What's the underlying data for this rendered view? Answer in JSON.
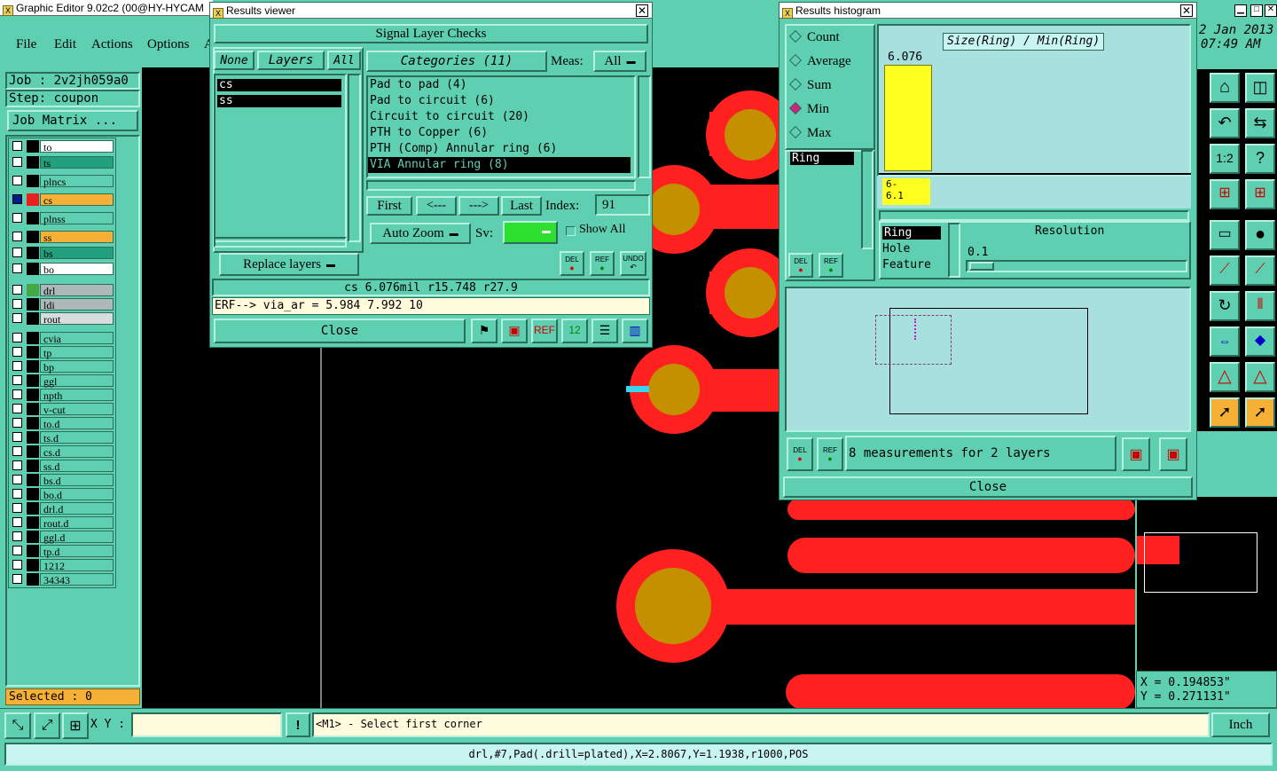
{
  "app": {
    "title": "Graphic Editor 9.02c2 (00@HY-HYCAM",
    "menu": [
      "File",
      "Edit",
      "Actions",
      "Options",
      "A"
    ],
    "job_label": "Job : 2v2jh059a0",
    "step_label": "Step: coupon",
    "job_matrix_label": "Job Matrix ...",
    "selected_label": "Selected : 0",
    "date": "2 Jan 2013",
    "time": "07:49 AM",
    "coord_x": "X = 0.194853\"",
    "coord_y": "Y = 0.271131\"",
    "xy_label": "X Y :",
    "xy_value": "",
    "prompt": "<M1> - Select first corner",
    "units": "Inch",
    "status_bar": "drl,#7,Pad(.drill=plated),X=2.8067,Y=1.1938,r1000,POS"
  },
  "layers": [
    {
      "name": "to",
      "color": "#ffffff",
      "swatch": "#000000"
    },
    {
      "name": "ts",
      "color": "#22a07e",
      "swatch": "#000000"
    },
    {
      "name": "plncs",
      "color": "#5fcfb1",
      "swatch": "#000000"
    },
    {
      "name": "cs",
      "color": "#f5b035",
      "swatch": "#e8201e",
      "active": true
    },
    {
      "name": "plnss",
      "color": "#5fcfb1",
      "swatch": "#000000"
    },
    {
      "name": "ss",
      "color": "#f5b035",
      "swatch": "#000000"
    },
    {
      "name": "bs",
      "color": "#22a07e",
      "swatch": "#000000"
    },
    {
      "name": "bo",
      "color": "#ffffff",
      "swatch": "#000000"
    },
    {
      "name": "drl",
      "color": "#aeb8b8",
      "swatch": "#44a844"
    },
    {
      "name": "ldi",
      "color": "#aeb8b8",
      "swatch": "#000000"
    },
    {
      "name": "rout",
      "color": "#d8dcdc",
      "swatch": "#000000"
    },
    {
      "name": "cvia",
      "color": "#5fcfb1",
      "swatch": "#000000"
    },
    {
      "name": "tp",
      "color": "#5fcfb1",
      "swatch": "#000000"
    },
    {
      "name": "bp",
      "color": "#5fcfb1",
      "swatch": "#000000"
    },
    {
      "name": "ggl",
      "color": "#5fcfb1",
      "swatch": "#000000"
    },
    {
      "name": "npth",
      "color": "#5fcfb1",
      "swatch": "#000000"
    },
    {
      "name": "v-cut",
      "color": "#5fcfb1",
      "swatch": "#000000"
    },
    {
      "name": "to.d",
      "color": "#5fcfb1",
      "swatch": "#000000"
    },
    {
      "name": "ts.d",
      "color": "#5fcfb1",
      "swatch": "#000000"
    },
    {
      "name": "cs.d",
      "color": "#5fcfb1",
      "swatch": "#000000"
    },
    {
      "name": "ss.d",
      "color": "#5fcfb1",
      "swatch": "#000000"
    },
    {
      "name": "bs.d",
      "color": "#5fcfb1",
      "swatch": "#000000"
    },
    {
      "name": "bo.d",
      "color": "#5fcfb1",
      "swatch": "#000000"
    },
    {
      "name": "drl.d",
      "color": "#5fcfb1",
      "swatch": "#000000"
    },
    {
      "name": "rout.d",
      "color": "#5fcfb1",
      "swatch": "#000000"
    },
    {
      "name": "ggl.d",
      "color": "#5fcfb1",
      "swatch": "#000000"
    },
    {
      "name": "tp.d",
      "color": "#5fcfb1",
      "swatch": "#000000"
    },
    {
      "name": "1212",
      "color": "#5fcfb1",
      "swatch": "#000000"
    },
    {
      "name": "34343",
      "color": "#5fcfb1",
      "swatch": "#000000"
    }
  ],
  "results_viewer": {
    "title": "Results viewer",
    "header": "Signal Layer Checks",
    "none_label": "None",
    "layers_label": "Layers",
    "all_label": "All",
    "layer_list": [
      "cs",
      "ss"
    ],
    "categories_label": "Categories (11)",
    "meas_label": "Meas:",
    "meas_value": "All",
    "categories": [
      "Pad to pad (4)",
      "Pad to circuit (6)",
      "Circuit to circuit (20)",
      "PTH to Copper (6)",
      "PTH (Comp) Annular ring (6)",
      "VIA Annular ring (8)"
    ],
    "selected_category": 5,
    "first_label": "First",
    "prev_label": "<---",
    "next_label": "--->",
    "last_label": "Last",
    "index_label": "Index:",
    "index_value": "91",
    "auto_zoom_label": "Auto Zoom",
    "sv_label": "Sv:",
    "show_all_label": "Show All",
    "replace_layers_label": "Replace layers",
    "del_label": "DEL",
    "ref_label": "REF",
    "undo_label": "UNDO",
    "info_line": "cs 6.076mil  r15.748  r27.9",
    "erf_line": "ERF--> via_ar = 5.984 7.992 10",
    "close_label": "Close"
  },
  "histogram": {
    "title": "Results histogram",
    "modes": [
      "Count",
      "Average",
      "Sum",
      "Min",
      "Max"
    ],
    "selected_mode": 3,
    "formula": "Size(Ring) / Min(Ring)",
    "bar_value_label": "6.076",
    "bar_range_label": "6-\n6.1",
    "measure_list": [
      "Ring"
    ],
    "sort_items": [
      "Ring",
      "Hole",
      "Feature"
    ],
    "resolution_label": "Resolution",
    "resolution_value": "0.1",
    "del_label": "DEL",
    "ref_label": "REF",
    "measurements_text": "8 measurements for 2 layers",
    "close_label": "Close"
  },
  "colors": {
    "panel": "#5fcfb1",
    "copper": "#ff2020",
    "drill": "#c49000",
    "canvas": "#000000",
    "hist_bar": "#ffff20"
  }
}
